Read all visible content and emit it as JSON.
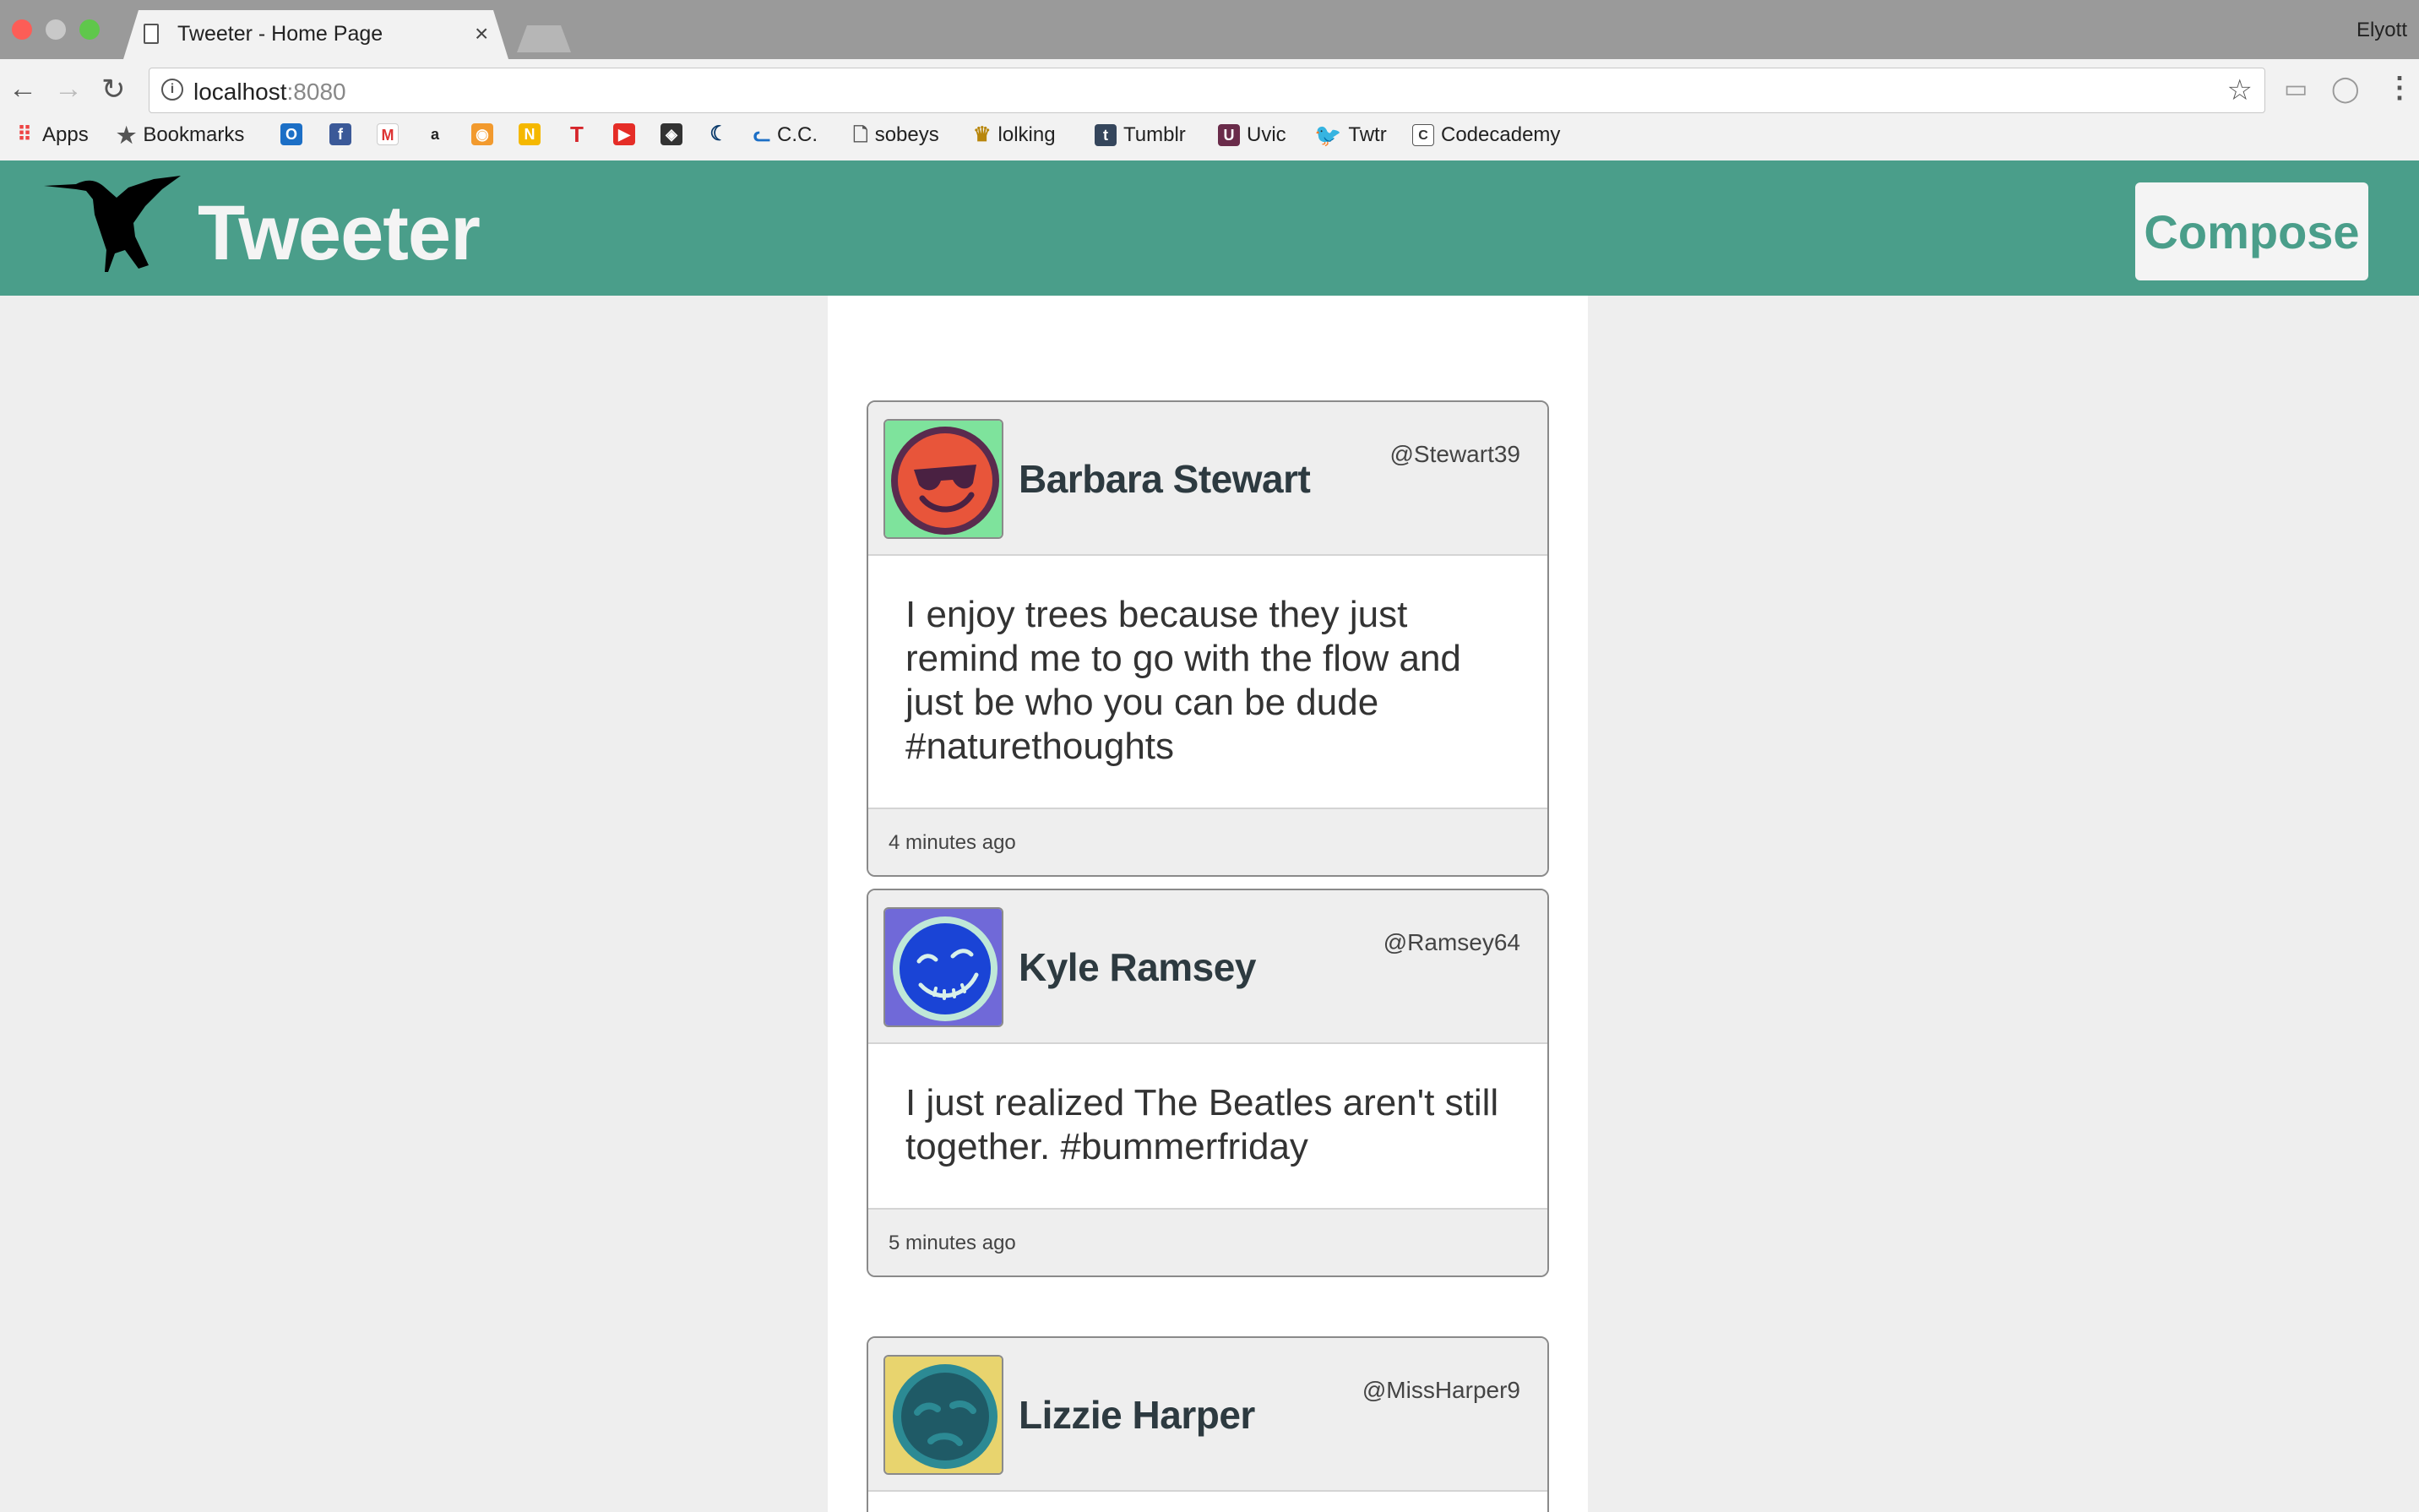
{
  "browser": {
    "tab_title": "Tweeter - Home Page",
    "tab_close": "×",
    "user_name": "Elyott",
    "url_host": "localhost",
    "url_port": ":8080",
    "bookmarks": [
      {
        "label": "Apps",
        "icon": "apps-grid-icon"
      },
      {
        "label": "Bookmarks",
        "icon": "star-icon"
      },
      {
        "label": "",
        "icon": "outlook-icon"
      },
      {
        "label": "",
        "icon": "facebook-icon"
      },
      {
        "label": "",
        "icon": "gmail-icon"
      },
      {
        "label": "",
        "icon": "amazon-icon"
      },
      {
        "label": "",
        "icon": "app-icon"
      },
      {
        "label": "",
        "icon": "n-icon"
      },
      {
        "label": "",
        "icon": "t-icon"
      },
      {
        "label": "",
        "icon": "youtube-icon"
      },
      {
        "label": "",
        "icon": "hockey-icon"
      },
      {
        "label": "",
        "icon": "canucks-icon"
      },
      {
        "label": "C.C.",
        "icon": "cc-icon"
      },
      {
        "label": "sobeys",
        "icon": "page-icon"
      },
      {
        "label": "lolking",
        "icon": "crown-icon"
      },
      {
        "label": "Tumblr",
        "icon": "tumblr-icon"
      },
      {
        "label": "Uvic",
        "icon": "uvic-icon"
      },
      {
        "label": "Twtr",
        "icon": "twitter-icon"
      },
      {
        "label": "Codecademy",
        "icon": "codecademy-icon"
      }
    ]
  },
  "header": {
    "brand": "Tweeter",
    "compose_label": "Compose"
  },
  "colors": {
    "accent": "#4a9e8a",
    "background": "#eeeeee"
  },
  "tweets": [
    {
      "name": "Barbara Stewart",
      "handle": "@Stewart39",
      "text": "I enjoy trees because they just remind me to go with the flow and just be who you can be dude #naturethoughts",
      "time": "4 minutes ago",
      "avatar_bg": "#7ee39c",
      "avatar_face": "#e8553a"
    },
    {
      "name": "Kyle Ramsey",
      "handle": "@Ramsey64",
      "text": "I just realized The Beatles aren't still together. #bummerfriday",
      "time": "5 minutes ago",
      "avatar_bg": "#7069d8",
      "avatar_face": "#1a44d6"
    },
    {
      "name": "Lizzie Harper",
      "handle": "@MissHarper9",
      "text": "",
      "time": "",
      "avatar_bg": "#e8d46e",
      "avatar_face": "#1f5a66"
    }
  ]
}
